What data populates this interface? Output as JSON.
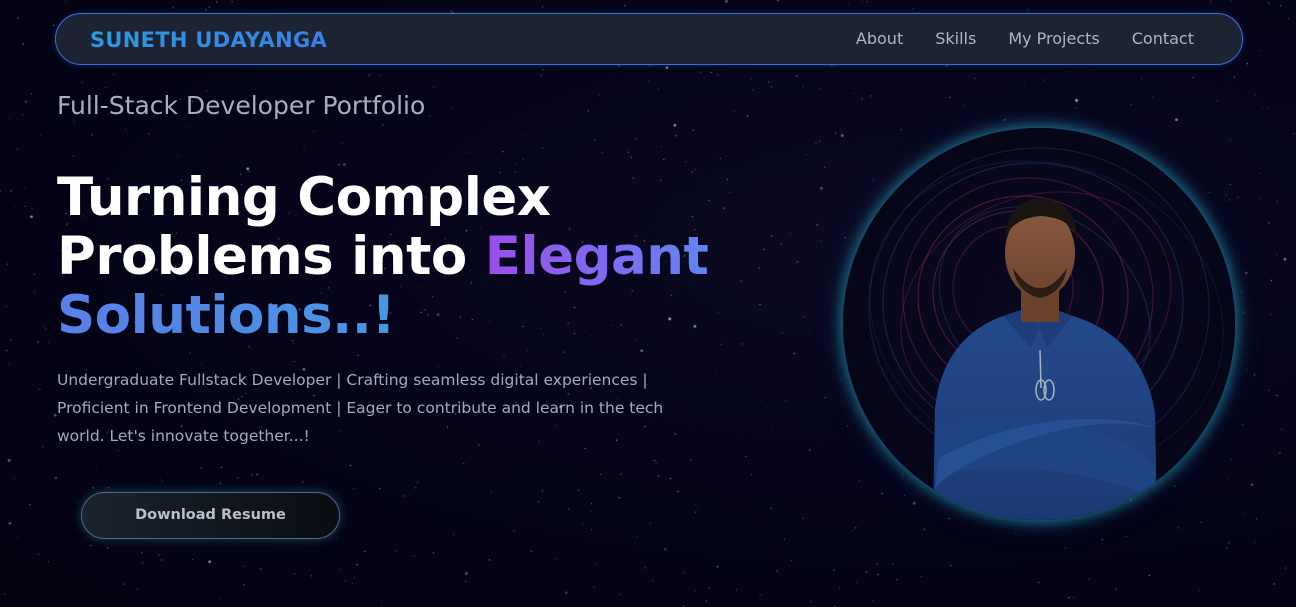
{
  "navbar": {
    "brand": "SUNETH UDAYANGA",
    "links": [
      {
        "label": "About"
      },
      {
        "label": "Skills"
      },
      {
        "label": "My Projects"
      },
      {
        "label": "Contact"
      }
    ]
  },
  "hero": {
    "eyebrow": "Full-Stack Developer Portfolio",
    "headline": {
      "line1": "Turning Complex",
      "line2_plain": "Problems into ",
      "line2_highlight": "Elegant",
      "line3_highlight": "Solutions..!"
    },
    "description": "Undergraduate Fullstack Developer | Crafting seamless digital experiences | Proficient in Frontend Development | Eager to contribute and learn in the tech world. Let's innovate together...!",
    "resume_button": "Download Resume"
  },
  "colors": {
    "background": "#04030f",
    "navbar_bg": "#1c2332",
    "navbar_border": "#3a6fd8",
    "brand": "#2a8fe0",
    "highlight_purple": "#9b4fe8",
    "highlight_blue": "#3ea3e0",
    "portrait_glow": "#28aac8"
  },
  "icons": {
    "portrait": "profile-photo"
  }
}
